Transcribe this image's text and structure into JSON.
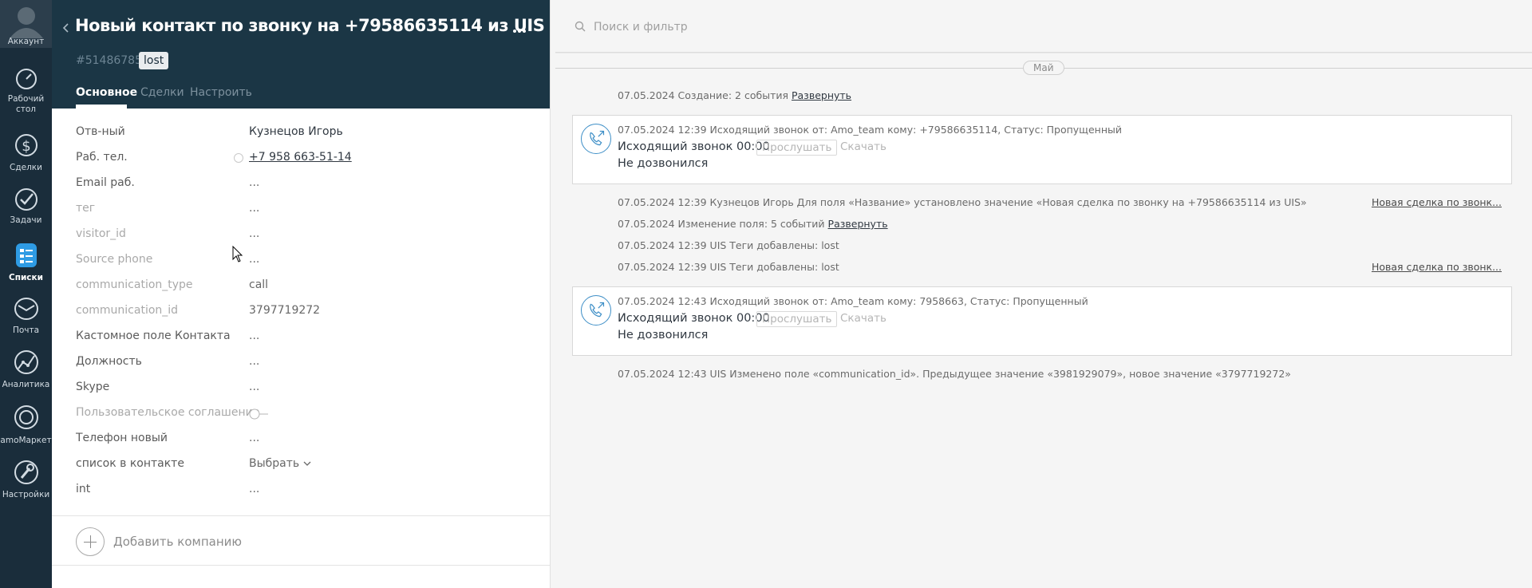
{
  "nav": {
    "account": "Аккаунт",
    "desktop_line1": "Рабочий",
    "desktop_line2": "стол",
    "deals": "Сделки",
    "tasks": "Задачи",
    "lists": "Списки",
    "mail": "Почта",
    "analytics": "Аналитика",
    "market": "amoМаркет",
    "settings": "Настройки",
    "colors": {
      "bg": "#1a2d3b",
      "active_icon": "#2e9be4"
    }
  },
  "card": {
    "title": "Новый контакт по звонку на +79586635114 из UIS",
    "id": "#51486785",
    "tag": "lost",
    "tabs": [
      {
        "label": "Основное",
        "active": true
      },
      {
        "label": "Сделки",
        "active": false
      },
      {
        "label": "Настроить",
        "active": false
      }
    ],
    "fields": [
      {
        "label": "Отв-ный",
        "value": "Кузнецов Игорь"
      },
      {
        "label": "Раб. тел.",
        "value": "+7 958 663-51-14"
      },
      {
        "label": "Email раб.",
        "value": "..."
      },
      {
        "label": "тег",
        "value": "..."
      },
      {
        "label": "visitor_id",
        "value": "..."
      },
      {
        "label": "Source phone",
        "value": "..."
      },
      {
        "label": "communication_type",
        "value": "call"
      },
      {
        "label": "communication_id",
        "value": "3797719272"
      },
      {
        "label": "Кастомное поле Контакта",
        "value": "..."
      },
      {
        "label": "Должность",
        "value": "..."
      },
      {
        "label": "Skype",
        "value": "..."
      },
      {
        "label": "Пользовательское соглашение",
        "value": ""
      },
      {
        "label": "Телефон новый",
        "value": "..."
      },
      {
        "label": "список в контакте",
        "value": "Выбрать"
      },
      {
        "label": "int",
        "value": "..."
      }
    ],
    "add_company": "Добавить компанию",
    "colors": {
      "header_bg": "#1b3645"
    }
  },
  "feed": {
    "search_placeholder": "Поиск и фильтр",
    "month": "Май",
    "note1_text": "07.05.2024 Создание: 2 события",
    "note1_link": "Развернуть",
    "call1": {
      "meta": "07.05.2024 12:39 Исходящий звонок от: Amo_team кому: +79586635114, Статус: Пропущенный",
      "title": "Исходящий звонок 00:00",
      "listen": "Прослушать",
      "download": "Скачать",
      "status": "Не дозвонился"
    },
    "note2_text": "07.05.2024 12:39 Кузнецов Игорь Для поля «Название» установлено значение «Новая сделка по звонку на +79586635114 из UIS»",
    "note2_side": "Новая сделка по звонк...",
    "note3_text": "07.05.2024 Изменение поля: 5 событий",
    "note3_link": "Развернуть",
    "note4_text": "07.05.2024 12:39 UIS Теги добавлены: lost",
    "note5_text": "07.05.2024 12:39 UIS Теги добавлены: lost",
    "note5_side": "Новая сделка по звонк...",
    "call2": {
      "meta": "07.05.2024 12:43 Исходящий звонок от: Amo_team кому: 7958663, Статус: Пропущенный",
      "title": "Исходящий звонок 00:00",
      "listen": "Прослушать",
      "download": "Скачать",
      "status": "Не дозвонился"
    },
    "note6_text": "07.05.2024 12:43 UIS Изменено поле «communication_id». Предыдущее значение «3981929079», новое значение «3797719272»"
  }
}
